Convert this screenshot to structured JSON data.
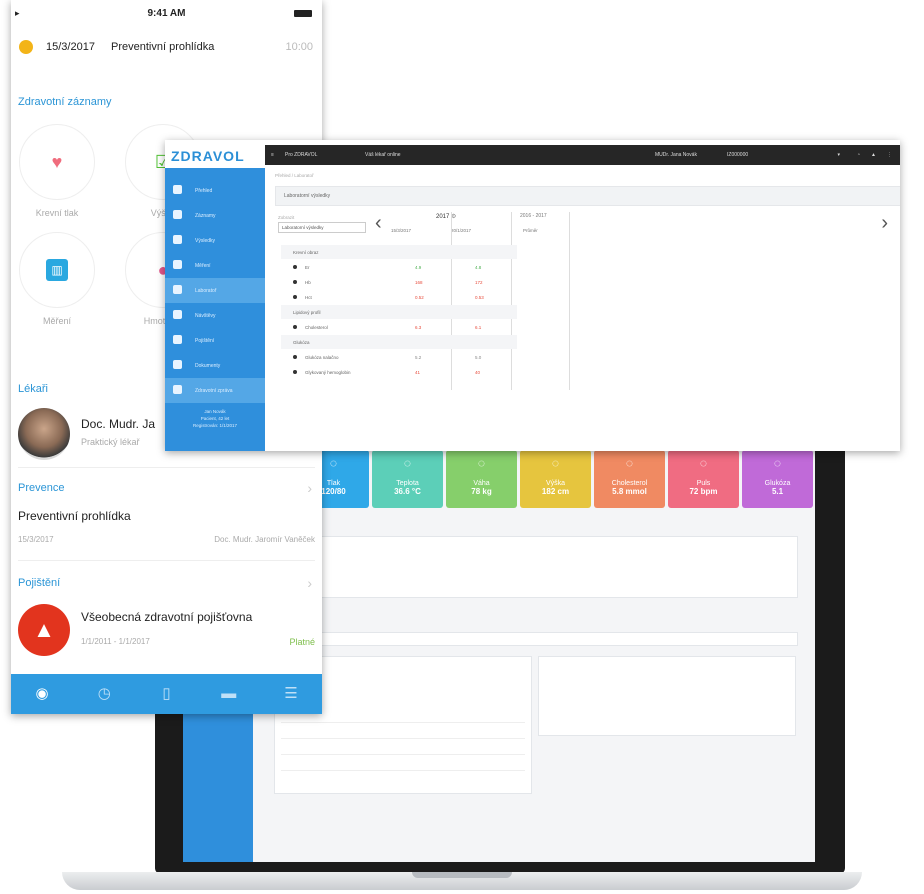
{
  "phone": {
    "status_time": "9:41 AM",
    "appointment": {
      "date": "15/3/2017",
      "title": "Preventivní prohlídka",
      "time": "10:00"
    },
    "records_title": "Zdravotní záznamy",
    "records": [
      {
        "label": "Krevní tlak",
        "icon": "heart-icon",
        "color": "#f06c7d"
      },
      {
        "label": "Výška",
        "icon": "checkbox-icon",
        "color": "#52c234"
      },
      {
        "label": "Měření",
        "icon": "chart-icon",
        "color": "#2aa8e0"
      },
      {
        "label": "Hmotnost",
        "icon": "scale-icon",
        "color": "#e2568b"
      }
    ],
    "doctor_section": "Lékaři",
    "doctor": {
      "name": "Doc. Mudr. Ja",
      "role": "Praktický lékař"
    },
    "prevention_section": "Prevence",
    "prevention": {
      "title": "Preventivní prohlídka",
      "date": "15/3/2017",
      "doctor": "Doc. Mudr. Jaromír Vaněček"
    },
    "insurance_section": "Pojištění",
    "insurance": {
      "name": "Všeobecná zdravotní pojišťovna",
      "dates": "1/1/2011 - 1/1/2017",
      "status": "Platné"
    },
    "tabs": [
      "home-icon",
      "history-icon",
      "book-icon",
      "chat-icon",
      "menu-icon"
    ]
  },
  "window": {
    "logo": "ZDRAVOL",
    "topbar": {
      "left": "Pro ZDRAVOL",
      "mid": "Váš lékař online",
      "user": "MUDr. Jana Novák",
      "id": "IZ000000"
    },
    "sidebar": [
      "Přehled",
      "Záznamy",
      "Výsledky",
      "Měření",
      "Laboratoř",
      "Návštěvy",
      "Pojištění",
      "Dokumenty",
      "Zdravotní zpráva"
    ],
    "sidebar_footer": [
      "Jan Novák",
      "Pacient, 42 let",
      "Registrován: 1/1/2017"
    ],
    "breadcrumb": "Přehled / Laboratoř",
    "panel_title": "Laboratorní výsledky",
    "select_label": "Zobrazit",
    "select_value": "Laboratorní výsledky",
    "year": "2017",
    "range": "2016 - 2017",
    "columns": [
      "15/3/2017",
      "20/1/2017",
      "Průměr"
    ],
    "rows": [
      {
        "group": true,
        "name": "Krevní obraz"
      },
      {
        "group": false,
        "name": "Er",
        "v1": "4.9",
        "v2": "4.8",
        "v1c": "#4caf50",
        "v2c": "#4caf50"
      },
      {
        "group": false,
        "name": "Hb",
        "v1": "168",
        "v2": "172",
        "v1c": "#e74c3c",
        "v2c": "#e74c3c"
      },
      {
        "group": false,
        "name": "Hct",
        "v1": "0.52",
        "v2": "0.53",
        "v1c": "#e74c3c",
        "v2c": "#e74c3c"
      },
      {
        "group": true,
        "name": "Lipidový profil"
      },
      {
        "group": false,
        "name": "Cholesterol",
        "v1": "6.3",
        "v2": "6.1",
        "v1c": "#e74c3c",
        "v2c": "#e74c3c"
      },
      {
        "group": true,
        "name": "Glukóza"
      },
      {
        "group": false,
        "name": "Glukóza nalačno",
        "v1": "5.2",
        "v2": "5.0",
        "v1c": "#888",
        "v2c": "#888"
      },
      {
        "group": false,
        "name": "Glykovaný hemoglobin",
        "v1": "41",
        "v2": "40",
        "v1c": "#e74c3c",
        "v2c": "#e74c3c"
      }
    ]
  },
  "laptop": {
    "tiles": [
      {
        "label": "Tlak",
        "value": "120/80",
        "color": "#2fa8e8"
      },
      {
        "label": "Teplota",
        "value": "36.6 °C",
        "color": "#5ccfb8"
      },
      {
        "label": "Váha",
        "value": "78 kg",
        "color": "#86cf6b"
      },
      {
        "label": "Výška",
        "value": "182 cm",
        "color": "#e6c53e"
      },
      {
        "label": "Cholesterol",
        "value": "5.8 mmol",
        "color": "#f08a62"
      },
      {
        "label": "Puls",
        "value": "72 bpm",
        "color": "#f06c82"
      },
      {
        "label": "Glukóza",
        "value": "5.1",
        "color": "#c06ad8"
      }
    ]
  }
}
